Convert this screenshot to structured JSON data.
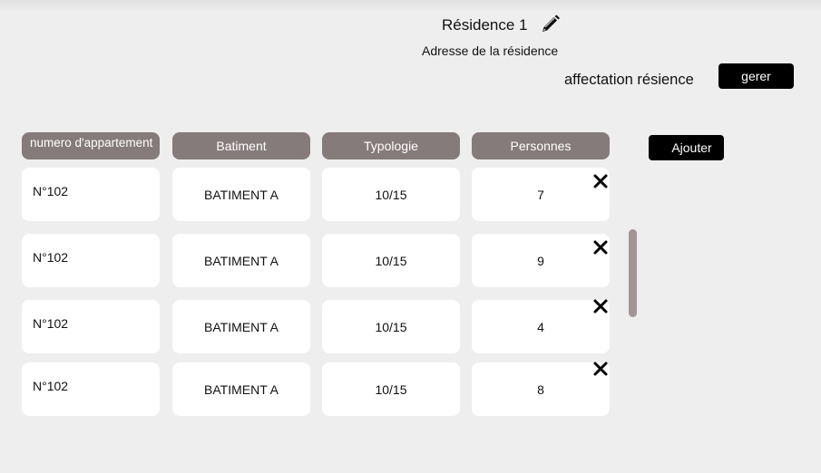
{
  "residence": {
    "title": "Résidence 1",
    "edit_icon": "pencil-icon",
    "address": "Adresse de la résidence"
  },
  "affectation": {
    "label": "affectation résience",
    "button": "gerer"
  },
  "actions": {
    "add_button": "Ajouter"
  },
  "table": {
    "columns": [
      "numero d'appartement",
      "Batiment",
      "Typologie",
      "Personnes"
    ],
    "rows": [
      {
        "numero": "N°102",
        "batiment": "BATIMENT A",
        "typologie": "10/15",
        "personnes": "7"
      },
      {
        "numero": "N°102",
        "batiment": "BATIMENT A",
        "typologie": "10/15",
        "personnes": "9"
      },
      {
        "numero": "N°102",
        "batiment": "BATIMENT A",
        "typologie": "10/15",
        "personnes": "4"
      },
      {
        "numero": "N°102",
        "batiment": "BATIMENT A",
        "typologie": "10/15",
        "personnes": "8"
      }
    ],
    "delete_icon": "close-icon"
  },
  "colors": {
    "background": "#eeeeee",
    "header": "#857b7b",
    "button": "#000000",
    "scrollbar": "#a19595"
  }
}
